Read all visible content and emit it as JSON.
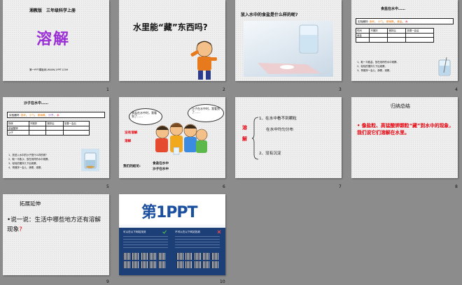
{
  "slides": [
    {
      "num": "1",
      "header": "湘教版　三年级科学上册",
      "title": "溶解",
      "footer": "第一PPT模板网-WWW.1PPT.COM"
    },
    {
      "num": "2",
      "question": "水里能“藏”东西吗?"
    },
    {
      "num": "3",
      "title": "放入水中的食盐是什么样的呢?"
    },
    {
      "num": "4",
      "title": "食盐在水中……",
      "equipment_label": "实验器材:",
      "equipment": [
        "食杯",
        "小勺",
        "玻璃棒",
        "食盐",
        "水"
      ],
      "table_header": [
        "时间",
        "不搅拌",
        "搅拌后",
        "放置一会后"
      ],
      "table_rows": [
        "食盐"
      ],
      "steps": [
        "1、取一平匙盐，放在烧杯的水中观察。",
        "2、轻轻的搅拌几下后观察。",
        "3、再搅拌一会儿，静置，观察。"
      ]
    },
    {
      "num": "5",
      "title": "沙子在水中……",
      "equipment_label": "实验器材:",
      "equipment": [
        "食杯",
        "小勺",
        "玻璃棒",
        "沙子",
        "水"
      ],
      "table_header": [
        "物体",
        "不搅拌",
        "搅拌后",
        "放置一会后"
      ],
      "table_rows": [
        "高锰酸钾",
        "沙子"
      ],
      "steps": [
        "1、放进入水中的沙子是什么样的呢?",
        "2、取一平匙沙，放在烧杯的水中观察。",
        "3、轻轻的搅拌几下后观察。",
        "4、再搅拌一会儿，静置，观察。"
      ]
    },
    {
      "num": "6",
      "bubble_left": "食盐在水中时，我看到了……",
      "bubble_right": "沙子在水中时，我看到了……",
      "label_no": "没有溶解",
      "label_yes": "溶解",
      "conclusion_label": "我们的结论:",
      "conclusion_items": [
        "食盐在水中",
        "沙子在水中"
      ]
    },
    {
      "num": "7",
      "brace_label": "溶\n\n解",
      "points": [
        "1、在水中看不到颗粒",
        "在水中均匀分布",
        "2、没有沉淀"
      ]
    },
    {
      "num": "8",
      "title": "归纳总结",
      "body": "像盐粒、高锰酸钾颗粒“藏”到水中的现象，我们说它们溶解在水里。"
    },
    {
      "num": "9",
      "title": "拓展延伸",
      "bullet": "•",
      "body_a": "说一说：生活中哪些地方还有溶解现象",
      "body_q": "?"
    },
    {
      "num": "10",
      "brand": "第1PPT",
      "left_head": "可以在以下网站找到",
      "right_head": "不可以在以下网站找到"
    }
  ],
  "colors": {
    "red": "#e8000b",
    "orange": "#f07800",
    "purple": "#7a20c8",
    "blue": "#1a4fa0"
  }
}
